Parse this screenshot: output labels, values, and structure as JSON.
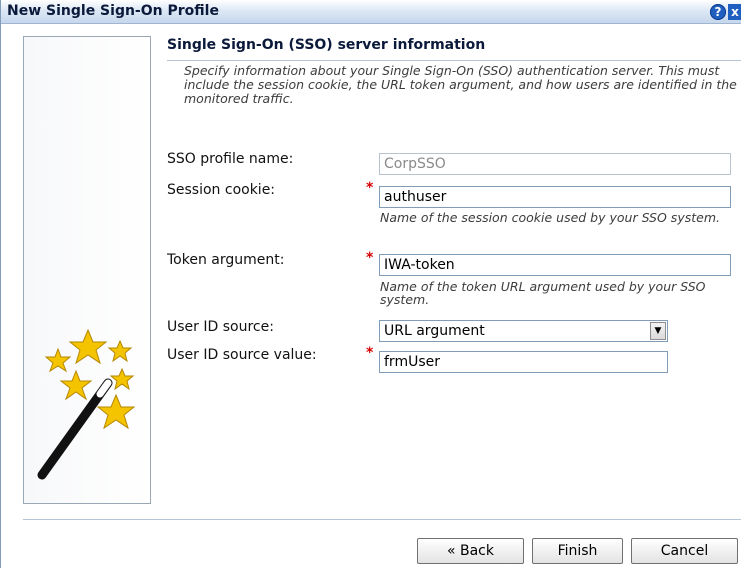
{
  "window": {
    "title": "New Single Sign-On Profile",
    "help_glyph": "?",
    "close_glyph": "x",
    "icons": [
      "help-icon",
      "close-icon",
      "magic-wand-icon",
      "chevron-down-icon"
    ]
  },
  "section": {
    "title": "Single Sign-On (SSO) server information",
    "description": "Specify information about your Single Sign-On (SSO) authentication server. This must include the session cookie, the URL token argument, and how users are identified in the monitored traffic."
  },
  "form": {
    "required_marker": "*",
    "profile_name": {
      "label": "SSO profile name:",
      "value": "CorpSSO"
    },
    "session_cookie": {
      "label": "Session cookie:",
      "value": "authuser",
      "hint": "Name of the session cookie used by your SSO system."
    },
    "token_argument": {
      "label": "Token argument:",
      "value": "IWA-token",
      "hint": "Name of the token URL argument used by your SSO system."
    },
    "user_id_source": {
      "label": "User ID source:",
      "value": "URL argument"
    },
    "user_id_source_value": {
      "label": "User ID source value:",
      "value": "frmUser"
    }
  },
  "buttons": {
    "back": "« Back",
    "finish": "Finish",
    "cancel": "Cancel"
  }
}
